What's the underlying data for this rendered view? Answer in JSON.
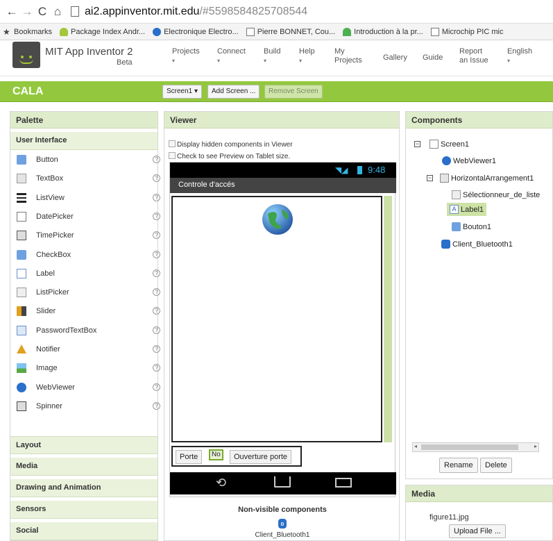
{
  "browser": {
    "url_host": "ai2.appinventor.mit.edu",
    "url_path": "/#5598584825708544",
    "bookmarks": [
      {
        "label": "Bookmarks",
        "icon": "star-icon"
      },
      {
        "label": "Package Index Andr...",
        "icon": "android-icon"
      },
      {
        "label": "Electronique Electro...",
        "icon": "globe-icon"
      },
      {
        "label": "Pierre BONNET, Cou...",
        "icon": "page-icon"
      },
      {
        "label": "Introduction à la pr...",
        "icon": "folder-icon"
      },
      {
        "label": "Microchip PIC mic",
        "icon": "page-icon"
      }
    ]
  },
  "header": {
    "brand": "MIT App Inventor 2",
    "beta": "Beta",
    "menus": [
      {
        "label": "Projects",
        "has_caret": true
      },
      {
        "label": "Connect",
        "has_caret": true
      },
      {
        "label": "Build",
        "has_caret": true
      },
      {
        "label": "Help",
        "has_caret": true
      },
      {
        "label": "My\nProjects",
        "has_caret": false
      },
      {
        "label": "Gallery",
        "has_caret": false
      },
      {
        "label": "Guide",
        "has_caret": false
      },
      {
        "label": "Report\nan Issue",
        "has_caret": false
      },
      {
        "label": "English",
        "has_caret": true
      }
    ]
  },
  "toolbar": {
    "project_name": "CALA",
    "screen_select": "Screen1 ▾",
    "add_screen": "Add Screen ...",
    "remove_screen": "Remove Screen"
  },
  "palette": {
    "title": "Palette",
    "section": "User Interface",
    "items": [
      {
        "label": "Button",
        "icon": "button-icon"
      },
      {
        "label": "TextBox",
        "icon": "textbox-icon"
      },
      {
        "label": "ListView",
        "icon": "listview-icon"
      },
      {
        "label": "DatePicker",
        "icon": "datepicker-icon"
      },
      {
        "label": "TimePicker",
        "icon": "timepicker-icon"
      },
      {
        "label": "CheckBox",
        "icon": "checkbox-icon"
      },
      {
        "label": "Label",
        "icon": "label-icon"
      },
      {
        "label": "ListPicker",
        "icon": "listpicker-icon"
      },
      {
        "label": "Slider",
        "icon": "slider-icon"
      },
      {
        "label": "PasswordTextBox",
        "icon": "password-icon"
      },
      {
        "label": "Notifier",
        "icon": "warning-icon"
      },
      {
        "label": "Image",
        "icon": "image-icon"
      },
      {
        "label": "WebViewer",
        "icon": "globe-icon"
      },
      {
        "label": "Spinner",
        "icon": "spinner-icon"
      }
    ],
    "help_glyph": "?",
    "categories": [
      "Layout",
      "Media",
      "Drawing and Animation",
      "Sensors",
      "Social"
    ]
  },
  "viewer": {
    "title": "Viewer",
    "check_hidden": "Display hidden components in Viewer",
    "check_tablet": "Check to see Preview on Tablet size.",
    "status_time": "9:48",
    "screen_title": "Controle d'accés",
    "buttons": {
      "porte": "Porte",
      "label_no": "No",
      "ouverture": "Ouverture porte"
    },
    "nonvisible_title": "Non-visible components",
    "nonvisible_item": "Client_Bluetooth1"
  },
  "components": {
    "title": "Components",
    "tree": [
      {
        "label": "Screen1",
        "icon": "screen-icon",
        "toggle": "⊟"
      },
      {
        "label": "WebViewer1",
        "icon": "globe-icon"
      },
      {
        "label": "HorizontalArrangement1",
        "icon": "harrangement-icon",
        "toggle": "⊟"
      },
      {
        "label": "Sélectionneur_de_liste",
        "icon": "listpicker-icon"
      },
      {
        "label": "Label1",
        "icon": "label-icon",
        "selected": true
      },
      {
        "label": "Bouton1",
        "icon": "button-icon"
      },
      {
        "label": "Client_Bluetooth1",
        "icon": "bluetooth-icon"
      }
    ],
    "rename": "Rename",
    "delete": "Delete"
  },
  "media": {
    "title": "Media",
    "file": "figure11.jpg",
    "upload": "Upload File ..."
  },
  "colors": {
    "accent_green": "#93c83e",
    "panel_header": "#dfeccb",
    "selection": "#cde3a6"
  }
}
